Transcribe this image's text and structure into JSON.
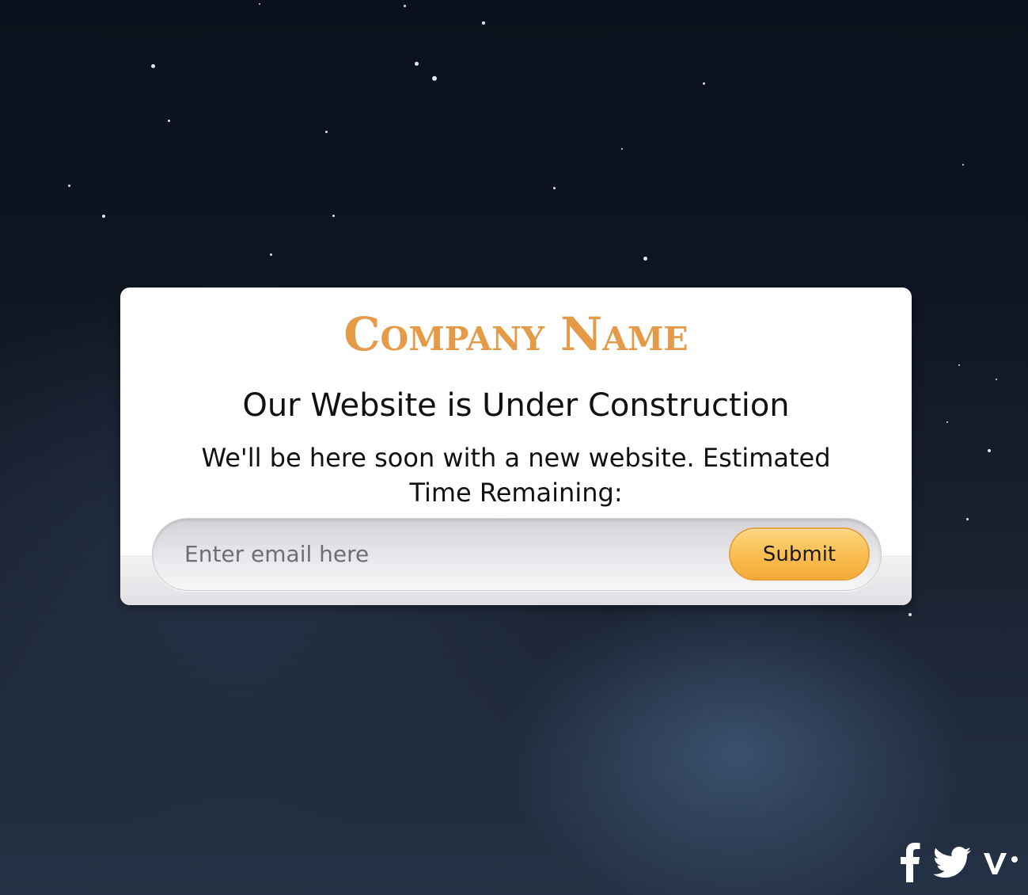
{
  "brand": {
    "name": "Company Name",
    "accent_color": "#e59a48"
  },
  "content": {
    "headline": "Our Website is Under Construction",
    "subline": "We'll be here soon with a new website. Estimated Time Remaining:"
  },
  "form": {
    "email_placeholder": "Enter email here",
    "email_value": "",
    "submit_label": "Submit",
    "submit_color": "#f9bb4c"
  },
  "social": {
    "items": [
      {
        "icon": "facebook-icon"
      },
      {
        "icon": "twitter-icon"
      },
      {
        "icon": "vine-icon"
      }
    ]
  }
}
